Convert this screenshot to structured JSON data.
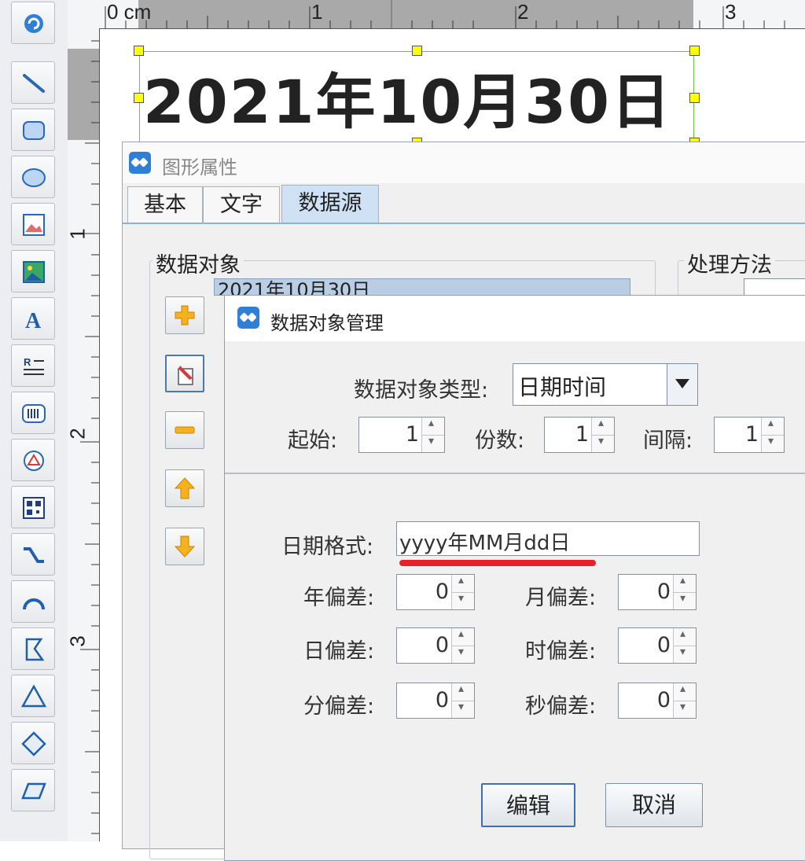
{
  "rulers": {
    "h_unit": "0 cm",
    "h_marks": [
      "1",
      "2",
      "3"
    ],
    "v_marks": [
      "1",
      "2",
      "3"
    ]
  },
  "canvas": {
    "selected_text": "2021年10月30日"
  },
  "properties_dialog": {
    "title": "图形属性",
    "tabs": [
      "基本",
      "文字",
      "数据源"
    ],
    "active_tab": "数据源",
    "data_object_group": "数据对象",
    "data_object_item": "2021年10月30日",
    "processing_group": "处理方法"
  },
  "data_object_manager": {
    "title": "数据对象管理",
    "type_label": "数据对象类型:",
    "type_value": "日期时间",
    "start_label": "起始:",
    "start_value": "1",
    "copies_label": "份数:",
    "copies_value": "1",
    "interval_label": "间隔:",
    "interval_value": "1",
    "date_format_label": "日期格式:",
    "date_format_value": "yyyy年MM月dd日",
    "year_offset_label": "年偏差:",
    "year_offset_value": "0",
    "month_offset_label": "月偏差:",
    "month_offset_value": "0",
    "day_offset_label": "日偏差:",
    "day_offset_value": "0",
    "hour_offset_label": "时偏差:",
    "hour_offset_value": "0",
    "minute_offset_label": "分偏差:",
    "minute_offset_value": "0",
    "second_offset_label": "秒偏差:",
    "second_offset_value": "0",
    "edit_button": "编辑",
    "cancel_button": "取消"
  },
  "colors": {
    "highlight_underline": "#e8202a",
    "handle": "#ffff00",
    "selection_border": "#6cc04a",
    "active_tab": "#cfe2f5"
  }
}
